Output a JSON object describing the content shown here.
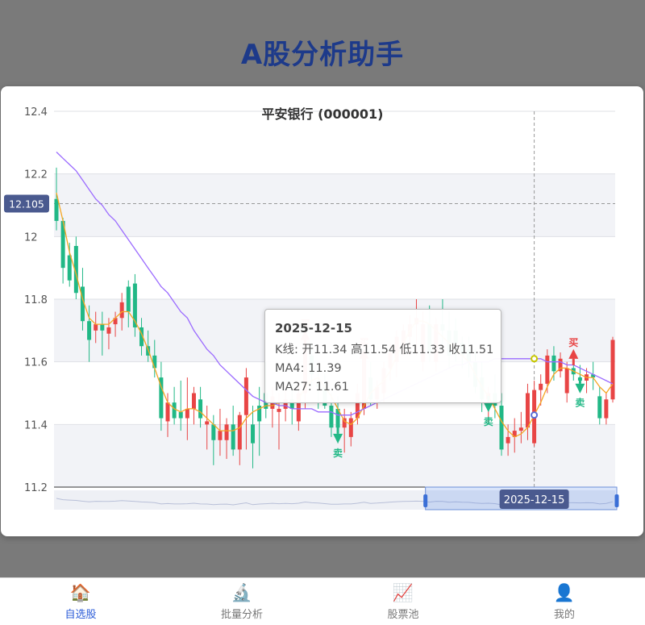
{
  "app": {
    "title": "A股分析助手"
  },
  "colors": {
    "up": "#e84545",
    "down": "#21b886",
    "ma4": "#f5a623",
    "ma27": "#9b6bff",
    "accent": "#2a5bd7",
    "title": "#1d3a8a"
  },
  "chart_data": {
    "type": "candlestick",
    "title": "平安银行 (000001)",
    "y_ticks": [
      "12.4",
      "12.2",
      "12",
      "11.8",
      "11.6",
      "11.4",
      "11.2"
    ],
    "ylim": [
      11.2,
      12.4
    ],
    "grid": true,
    "crosshair": {
      "y_value_label": "12.105",
      "y_value": 12.105,
      "x_label": "2025-12-15",
      "x_index": 73
    },
    "series": [
      {
        "name": "K线",
        "ohlc": [
          [
            12.12,
            12.22,
            12.02,
            12.05
          ],
          [
            12.05,
            12.06,
            11.85,
            11.9
          ],
          [
            11.94,
            11.98,
            11.84,
            11.86
          ],
          [
            11.97,
            12.0,
            11.8,
            11.82
          ],
          [
            11.84,
            11.9,
            11.7,
            11.73
          ],
          [
            11.73,
            11.78,
            11.6,
            11.67
          ],
          [
            11.7,
            11.76,
            11.66,
            11.72
          ],
          [
            11.72,
            11.76,
            11.62,
            11.7
          ],
          [
            11.69,
            11.74,
            11.64,
            11.71
          ],
          [
            11.72,
            11.76,
            11.68,
            11.74
          ],
          [
            11.74,
            11.82,
            11.7,
            11.79
          ],
          [
            11.84,
            11.86,
            11.71,
            11.76
          ],
          [
            11.85,
            11.88,
            11.68,
            11.71
          ],
          [
            11.71,
            11.74,
            11.62,
            11.65
          ],
          [
            11.65,
            11.7,
            11.6,
            11.62
          ],
          [
            11.62,
            11.67,
            11.55,
            11.58
          ],
          [
            11.55,
            11.6,
            11.38,
            11.42
          ],
          [
            11.41,
            11.5,
            11.36,
            11.47
          ],
          [
            11.47,
            11.52,
            11.4,
            11.42
          ],
          [
            11.44,
            11.54,
            11.38,
            11.42
          ],
          [
            11.42,
            11.55,
            11.35,
            11.45
          ],
          [
            11.45,
            11.52,
            11.4,
            11.5
          ],
          [
            11.48,
            11.52,
            11.39,
            11.42
          ],
          [
            11.4,
            11.46,
            11.32,
            11.41
          ],
          [
            11.4,
            11.43,
            11.27,
            11.35
          ],
          [
            11.35,
            11.45,
            11.3,
            11.38
          ],
          [
            11.35,
            11.42,
            11.29,
            11.4
          ],
          [
            11.4,
            11.46,
            11.3,
            11.32
          ],
          [
            11.32,
            11.44,
            11.27,
            11.43
          ],
          [
            11.43,
            11.58,
            11.32,
            11.55
          ],
          [
            11.4,
            11.46,
            11.26,
            11.34
          ],
          [
            11.46,
            11.52,
            11.3,
            11.41
          ],
          [
            11.5,
            11.6,
            11.42,
            11.45
          ],
          [
            11.45,
            11.52,
            11.39,
            11.49
          ],
          [
            11.44,
            11.5,
            11.32,
            11.45
          ],
          [
            11.45,
            11.53,
            11.41,
            11.48
          ],
          [
            11.48,
            11.53,
            11.4,
            11.45
          ],
          [
            11.41,
            11.52,
            11.38,
            11.5
          ],
          [
            11.5,
            11.68,
            11.45,
            11.64
          ],
          [
            11.62,
            11.66,
            11.52,
            11.56
          ],
          [
            11.53,
            11.58,
            11.45,
            11.52
          ],
          [
            11.52,
            11.56,
            11.45,
            11.46
          ],
          [
            11.46,
            11.5,
            11.36,
            11.39
          ],
          [
            11.45,
            11.49,
            11.34,
            11.39
          ],
          [
            11.39,
            11.45,
            11.31,
            11.42
          ],
          [
            11.36,
            11.44,
            11.33,
            11.42
          ],
          [
            11.42,
            11.53,
            11.4,
            11.5
          ],
          [
            11.45,
            11.65,
            11.43,
            11.62
          ],
          [
            11.55,
            11.6,
            11.46,
            11.48
          ],
          [
            11.48,
            11.54,
            11.45,
            11.52
          ],
          [
            11.5,
            11.6,
            11.47,
            11.58
          ],
          [
            11.58,
            11.66,
            11.54,
            11.63
          ],
          [
            11.6,
            11.7,
            11.55,
            11.68
          ],
          [
            11.65,
            11.72,
            11.62,
            11.7
          ],
          [
            11.68,
            11.75,
            11.62,
            11.72
          ],
          [
            11.72,
            11.8,
            11.62,
            11.74
          ],
          [
            11.6,
            11.76,
            11.57,
            11.72
          ],
          [
            11.72,
            11.78,
            11.6,
            11.63
          ],
          [
            11.6,
            11.74,
            11.57,
            11.72
          ],
          [
            11.72,
            11.8,
            11.65,
            11.7
          ],
          [
            11.7,
            11.76,
            11.58,
            11.62
          ],
          [
            11.7,
            11.74,
            11.6,
            11.66
          ],
          [
            11.66,
            11.68,
            11.58,
            11.62
          ],
          [
            11.64,
            11.68,
            11.55,
            11.6
          ],
          [
            11.6,
            11.64,
            11.5,
            11.52
          ],
          [
            11.55,
            11.6,
            11.44,
            11.48
          ],
          [
            11.48,
            11.52,
            11.4,
            11.5
          ],
          [
            11.5,
            11.56,
            11.42,
            11.46
          ],
          [
            11.46,
            11.5,
            11.3,
            11.32
          ],
          [
            11.34,
            11.4,
            11.3,
            11.36
          ],
          [
            11.36,
            11.42,
            11.31,
            11.38
          ],
          [
            11.38,
            11.44,
            11.34,
            11.39
          ],
          [
            11.39,
            11.53,
            11.35,
            11.5
          ],
          [
            11.34,
            11.54,
            11.33,
            11.51
          ],
          [
            11.51,
            11.56,
            11.46,
            11.53
          ],
          [
            11.53,
            11.64,
            11.5,
            11.62
          ],
          [
            11.62,
            11.65,
            11.54,
            11.57
          ],
          [
            11.57,
            11.63,
            11.55,
            11.61
          ],
          [
            11.5,
            11.6,
            11.47,
            11.58
          ],
          [
            11.58,
            11.62,
            11.54,
            11.56
          ],
          [
            11.55,
            11.59,
            11.52,
            11.54
          ],
          [
            11.54,
            11.58,
            11.5,
            11.56
          ],
          [
            11.56,
            11.6,
            11.51,
            11.55
          ],
          [
            11.49,
            11.52,
            11.4,
            11.42
          ],
          [
            11.42,
            11.5,
            11.4,
            11.48
          ],
          [
            11.48,
            11.68,
            11.47,
            11.67
          ]
        ]
      },
      {
        "name": "MA4",
        "values": [
          12.14,
          12.05,
          11.95,
          11.88,
          11.8,
          11.74,
          11.72,
          11.72,
          11.72,
          11.74,
          11.76,
          11.76,
          11.73,
          11.69,
          11.64,
          11.58,
          11.52,
          11.47,
          11.45,
          11.44,
          11.45,
          11.45,
          11.44,
          11.42,
          11.4,
          11.38,
          11.38,
          11.38,
          11.39,
          11.42,
          11.44,
          11.45,
          11.46,
          11.46,
          11.47,
          11.47,
          11.47,
          11.48,
          11.52,
          11.54,
          11.55,
          11.52,
          11.49,
          11.45,
          11.41,
          11.4,
          11.42,
          11.46,
          11.5,
          11.52,
          11.54,
          11.57,
          11.62,
          11.66,
          11.7,
          11.73,
          11.73,
          11.72,
          11.7,
          11.68,
          11.66,
          11.64,
          11.62,
          11.6,
          11.56,
          11.52,
          11.49,
          11.45,
          11.41,
          11.38,
          11.36,
          11.37,
          11.39,
          11.43,
          11.47,
          11.52,
          11.56,
          11.58,
          11.58,
          11.57,
          11.56,
          11.55,
          11.55,
          11.52,
          11.5,
          11.53
        ]
      },
      {
        "name": "MA27",
        "values": [
          12.27,
          12.25,
          12.23,
          12.21,
          12.18,
          12.15,
          12.12,
          12.1,
          12.07,
          12.05,
          12.02,
          11.99,
          11.96,
          11.93,
          11.9,
          11.87,
          11.84,
          11.82,
          11.79,
          11.76,
          11.74,
          11.7,
          11.67,
          11.64,
          11.62,
          11.59,
          11.57,
          11.55,
          11.53,
          11.51,
          11.49,
          11.48,
          11.47,
          11.47,
          11.46,
          11.46,
          11.45,
          11.45,
          11.45,
          11.45,
          11.44,
          11.44,
          11.44,
          11.43,
          11.43,
          11.43,
          11.44,
          11.45,
          11.46,
          11.47,
          11.48,
          11.49,
          11.5,
          11.51,
          11.52,
          11.53,
          11.54,
          11.55,
          11.56,
          11.57,
          11.58,
          11.59,
          11.59,
          11.6,
          11.6,
          11.6,
          11.6,
          11.61,
          11.61,
          11.61,
          11.61,
          11.61,
          11.61,
          11.61,
          11.61,
          11.6,
          11.6,
          11.6,
          11.59,
          11.59,
          11.58,
          11.57,
          11.56,
          11.55,
          11.54,
          11.53
        ]
      }
    ],
    "signals": [
      {
        "type": "buy",
        "label": "买",
        "index": 38,
        "price": 11.68
      },
      {
        "type": "buy",
        "label": "买",
        "index": 47,
        "price": 11.62
      },
      {
        "type": "sell",
        "label": "卖",
        "index": 43,
        "price": 11.36
      },
      {
        "type": "sell",
        "label": "卖",
        "index": 66,
        "price": 11.46
      },
      {
        "type": "buy",
        "label": "买",
        "index": 79,
        "price": 11.62
      },
      {
        "type": "sell",
        "label": "卖",
        "index": 80,
        "price": 11.52
      }
    ],
    "zoom_range": [
      0.66,
      1.0
    ]
  },
  "tooltip": {
    "date": "2025-12-15",
    "kline": "K线: 开11.34 高11.54 低11.33 收11.51",
    "ma4": "MA4: 11.39",
    "ma27": "MA27: 11.61"
  },
  "nav": {
    "items": [
      {
        "label": "自选股",
        "icon": "home-icon",
        "glyph": "🏠",
        "active": true
      },
      {
        "label": "批量分析",
        "icon": "microscope-icon",
        "glyph": "🔬",
        "active": false
      },
      {
        "label": "股票池",
        "icon": "chart-up-icon",
        "glyph": "📈",
        "active": false
      },
      {
        "label": "我的",
        "icon": "user-icon",
        "glyph": "👤",
        "active": false
      }
    ]
  }
}
